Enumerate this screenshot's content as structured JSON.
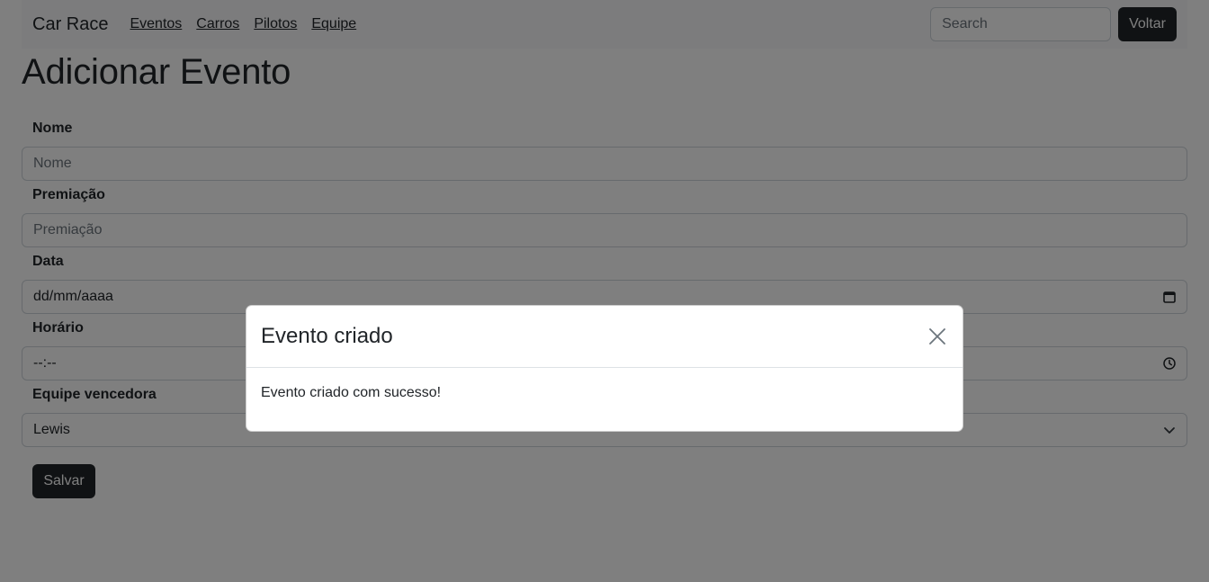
{
  "navbar": {
    "brand": "Car Race",
    "links": [
      "Eventos",
      "Carros",
      "Pilotos",
      "Equipe"
    ],
    "search_placeholder": "Search",
    "back_label": "Voltar"
  },
  "page_title": "Adicionar Evento",
  "form": {
    "nome": {
      "label": "Nome",
      "placeholder": "Nome"
    },
    "premiacao": {
      "label": "Premiação",
      "placeholder": "Premiação"
    },
    "data": {
      "label": "Data",
      "value": "dd/mm/aaaa",
      "icon": "calendar-icon"
    },
    "horario": {
      "label": "Horário",
      "value": "--:--",
      "icon": "clock-icon"
    },
    "equipe": {
      "label": "Equipe vencedora",
      "value": "Lewis",
      "icon": "chevron-down-icon"
    },
    "save_label": "Salvar"
  },
  "modal": {
    "title": "Evento criado",
    "body": "Evento criado com sucesso!",
    "close_icon": "close-icon"
  },
  "colors": {
    "dark_button": "#212529",
    "backdrop": "rgba(0,0,0,0.5)",
    "navbar_bg": "#f8f9fa"
  }
}
